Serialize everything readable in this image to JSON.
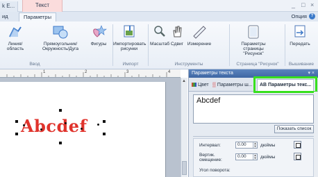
{
  "titlebar": {
    "left_tab": "k E...",
    "context_tab": "Текст",
    "minimize": "_",
    "maximize": "□",
    "close": "×"
  },
  "ribbon_tabs": {
    "tabs": [
      {
        "label": "ид"
      },
      {
        "label": "Параметры"
      }
    ],
    "options": "Опция",
    "help": "?"
  },
  "ribbon": {
    "groups": {
      "input": "Ввод",
      "import": "Импорт",
      "tools": "Инструменты",
      "page": "Страница \"Рисунок\"",
      "embroidery": "Вышивание"
    },
    "buttons": {
      "line_area": "Линия/область",
      "rectangle_circle_arc": "Прямоугольник/ Окружность/Дуга",
      "shapes": "Фигуры",
      "import_images": "Импортировать рисунки",
      "zoom": "Масштаб",
      "pan": "Сдвиг",
      "measure": "Измерение",
      "page_params": "Параметры страницы \"Рисунок\"",
      "transfer": "Передать"
    }
  },
  "canvas": {
    "text": "Abcdef"
  },
  "panel": {
    "title": "Параметры текста",
    "pin": "▾ ×",
    "tabs": [
      {
        "label": "Цвет"
      },
      {
        "label": "Параметры ш..."
      },
      {
        "label": "AB Параметры текс..."
      }
    ],
    "text_value": "Abcdef",
    "show_list": "Показать список",
    "props": {
      "interval_label": "Интервал:",
      "interval_value": "0.00",
      "interval_unit": "дюймы",
      "vshift_label": "Вертик. смещение:",
      "vshift_value": "0.00",
      "vshift_unit": "дюймы",
      "rotation_label": "Угол поворота:"
    }
  },
  "ruler": {
    "numbers": [
      "1",
      "2",
      "3",
      "4"
    ]
  },
  "colors": {
    "highlight": "#37e01d",
    "text_red": "#e0332c",
    "panel_header": "#3e66a3"
  }
}
